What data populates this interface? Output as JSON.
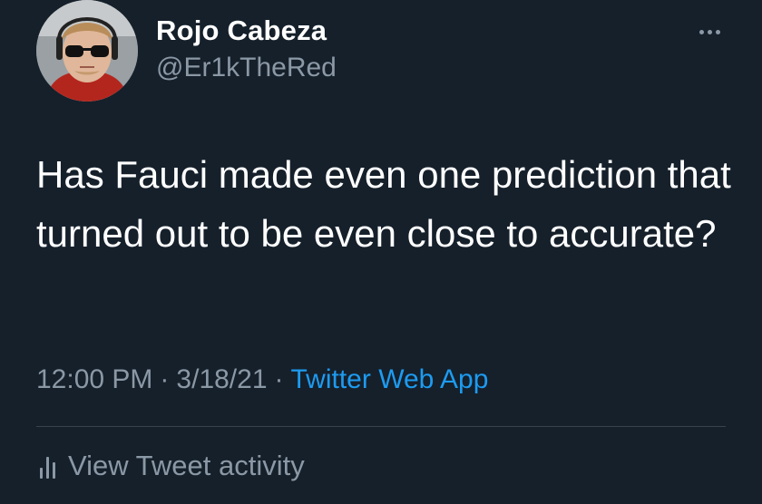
{
  "user": {
    "display_name": "Rojo Cabeza",
    "handle": "@Er1kTheRed"
  },
  "tweet": {
    "text": "Has Fauci made even one prediction that turned out to be even close to accurate?",
    "time": "12:00 PM",
    "date": "3/18/21",
    "separator": "·",
    "source": "Twitter Web App"
  },
  "activity": {
    "label": "View Tweet activity",
    "icon": "bar-chart-icon"
  },
  "menu": {
    "icon": "more-dots-icon"
  },
  "colors": {
    "background": "#15202b",
    "text": "#ffffff",
    "secondary": "#8b98a5",
    "accent": "#1d9bf0",
    "divider": "#38444d"
  }
}
